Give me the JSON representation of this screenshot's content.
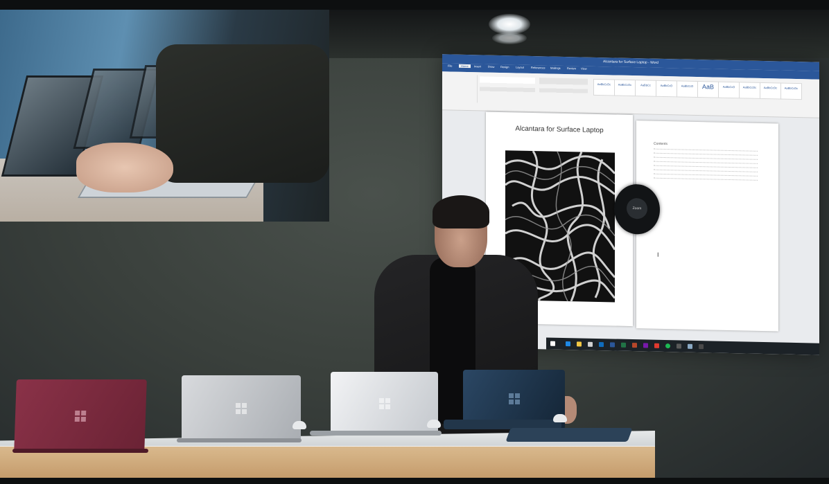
{
  "word_window": {
    "title": "Alcantara for Surface Laptop - Word",
    "tabs": [
      "File",
      "Home",
      "Insert",
      "Draw",
      "Design",
      "Layout",
      "References",
      "Mailings",
      "Review",
      "View"
    ],
    "styles": [
      "AaBbCcDc",
      "AaBbCcDc",
      "AaBbCc",
      "AaBbCcD",
      "AaBbCcD",
      "AaB",
      "AaBbCcD",
      "AaBbCcDc",
      "AaBbCcDc",
      "AaBbCcDc",
      "AaBbCcDc"
    ],
    "document_title": "Alcantara for Surface Laptop",
    "contents_heading": "Contents",
    "toc_items": [
      "",
      "",
      "",
      "",
      "",
      "",
      "",
      ""
    ],
    "dial_label": "Zoom"
  },
  "colors": {
    "word_blue": "#2b579a",
    "laptop_burgundy": "#7c2a3e",
    "laptop_platinum": "#c9cbce",
    "laptop_silver": "#e3e5e8",
    "laptop_cobalt": "#1d3147"
  },
  "icons": [
    "windows-logo-icon",
    "text-cursor-icon",
    "taskbar-icons"
  ]
}
